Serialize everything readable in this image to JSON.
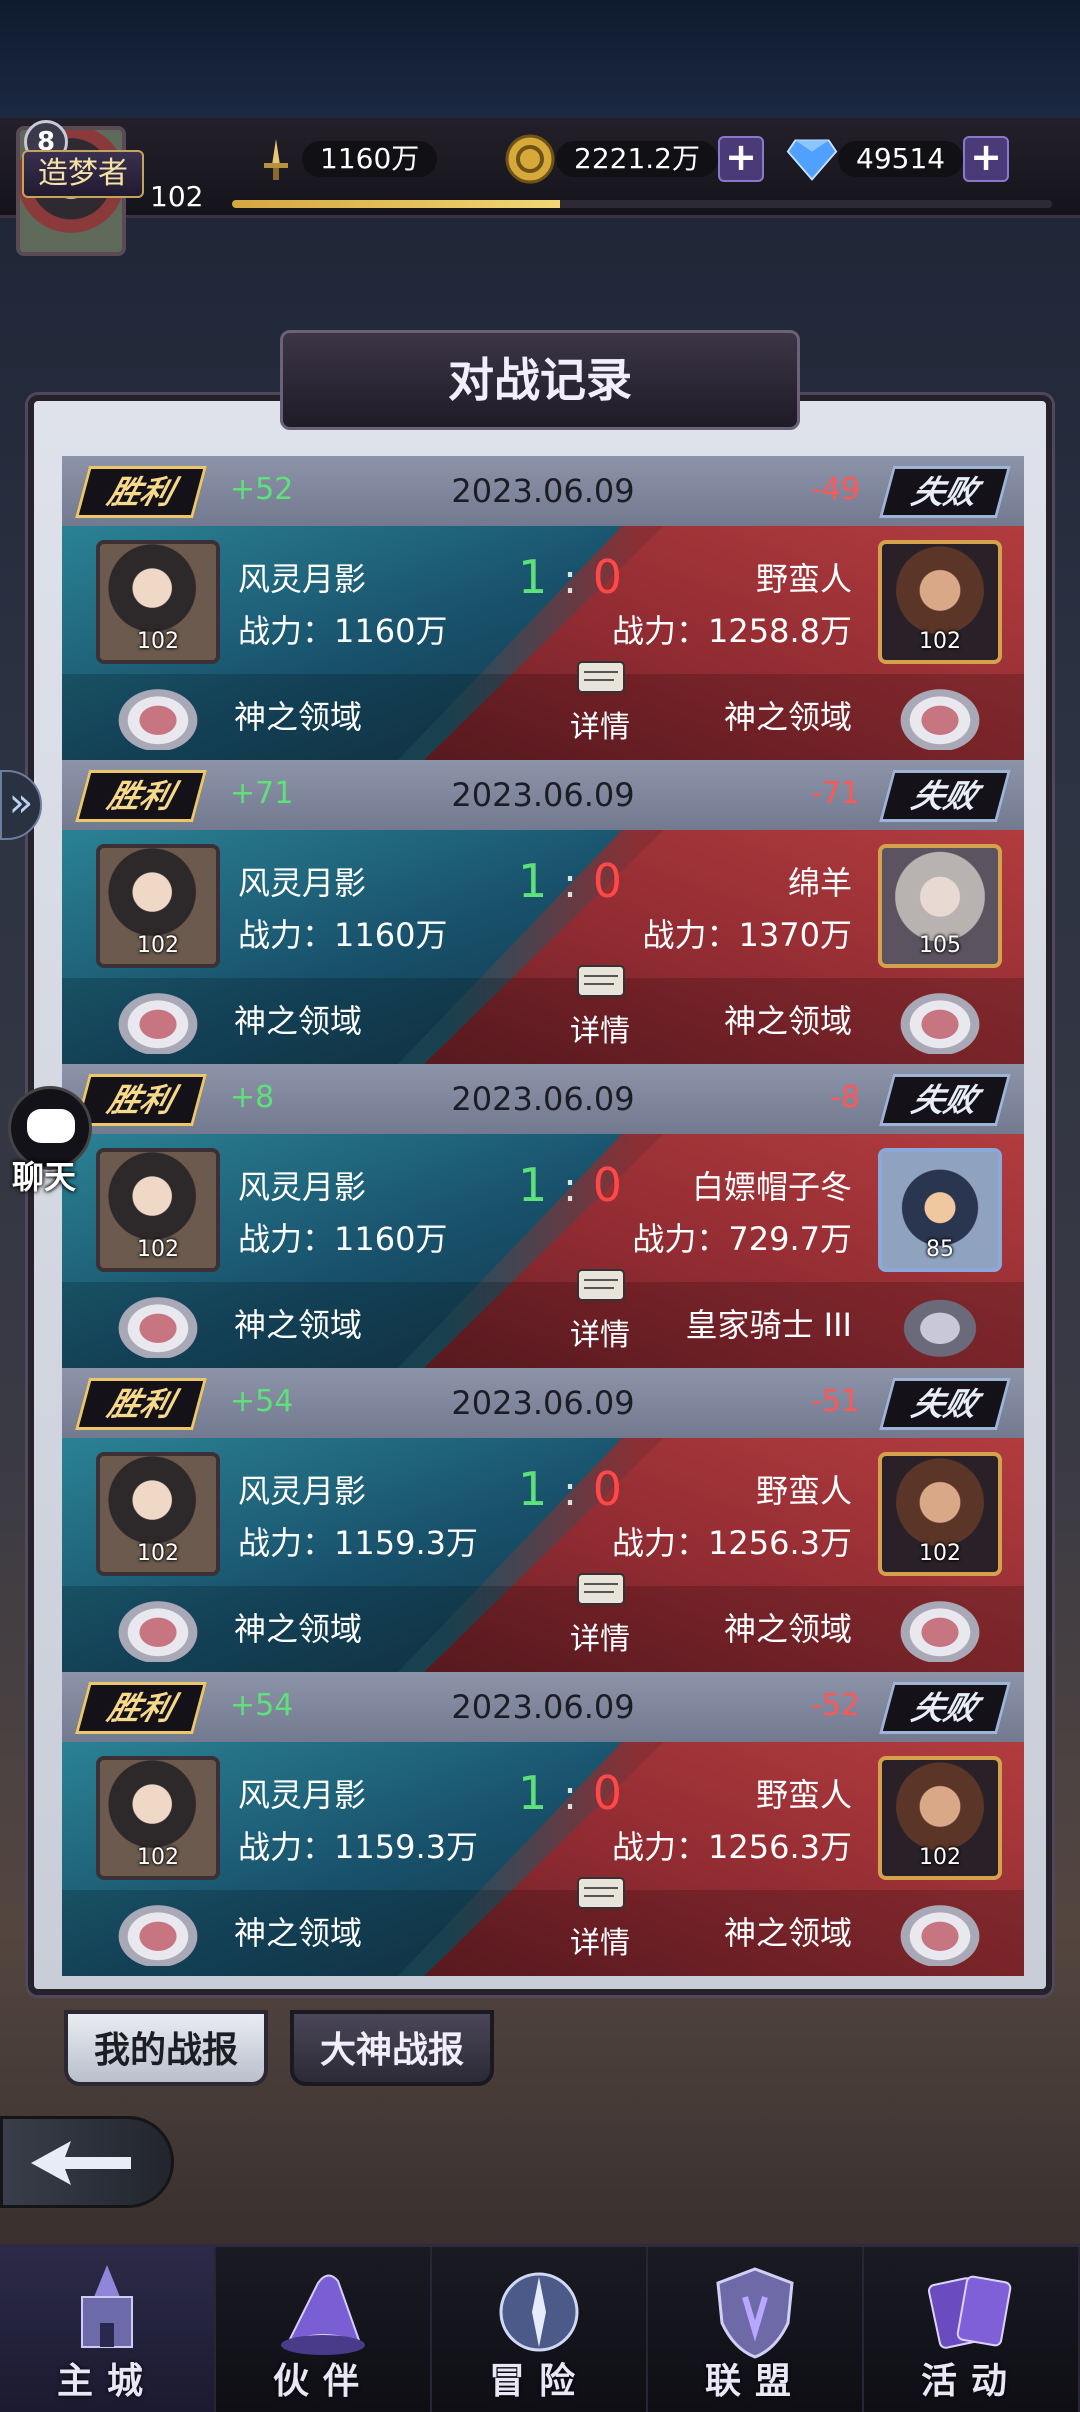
{
  "header": {
    "player_level_badge": "8",
    "player_level": "102",
    "rank_title": "造梦者",
    "resources": {
      "power": "1160万",
      "gold": "2221.2万",
      "gems": "49514"
    },
    "exp_progress": 0.4
  },
  "panel": {
    "title": "对战记录",
    "detail_label": "详情",
    "win_label": "胜利",
    "lose_label": "失败",
    "power_prefix": "战力：",
    "score_sep": ":"
  },
  "records": [
    {
      "win_points": "+52",
      "date": "2023.06.09",
      "lose_points": "-49",
      "me": {
        "name": "风灵月影",
        "power": "战力：1160万",
        "level": "102",
        "domain": "神之领域"
      },
      "score_left": "1",
      "score_right": "0",
      "opp": {
        "name": "野蛮人",
        "power": "战力：1258.8万",
        "level": "102",
        "domain": "神之领域"
      }
    },
    {
      "win_points": "+71",
      "date": "2023.06.09",
      "lose_points": "-71",
      "me": {
        "name": "风灵月影",
        "power": "战力：1160万",
        "level": "102",
        "domain": "神之领域"
      },
      "score_left": "1",
      "score_right": "0",
      "opp": {
        "name": "绵羊",
        "power": "战力：1370万",
        "level": "105",
        "domain": "神之领域"
      }
    },
    {
      "win_points": "+8",
      "date": "2023.06.09",
      "lose_points": "-8",
      "me": {
        "name": "风灵月影",
        "power": "战力：1160万",
        "level": "102",
        "domain": "神之领域"
      },
      "score_left": "1",
      "score_right": "0",
      "opp": {
        "name": "白嫖帽子冬",
        "power": "战力：729.7万",
        "level": "85",
        "domain": "皇家骑士 III"
      }
    },
    {
      "win_points": "+54",
      "date": "2023.06.09",
      "lose_points": "-51",
      "me": {
        "name": "风灵月影",
        "power": "战力：1159.3万",
        "level": "102",
        "domain": "神之领域"
      },
      "score_left": "1",
      "score_right": "0",
      "opp": {
        "name": "野蛮人",
        "power": "战力：1256.3万",
        "level": "102",
        "domain": "神之领域"
      }
    },
    {
      "win_points": "+54",
      "date": "2023.06.09",
      "lose_points": "-52",
      "me": {
        "name": "风灵月影",
        "power": "战力：1159.3万",
        "level": "102",
        "domain": "神之领域"
      },
      "score_left": "1",
      "score_right": "0",
      "opp": {
        "name": "野蛮人",
        "power": "战力：1256.3万",
        "level": "102",
        "domain": "神之领域"
      }
    }
  ],
  "tabs": {
    "my_reports": "我的战报",
    "master_reports": "大神战报"
  },
  "side": {
    "chat_label": "聊天"
  },
  "nav": {
    "items": [
      {
        "label": "主城",
        "icon": "castle-icon"
      },
      {
        "label": "伙伴",
        "icon": "wizard-hat-icon"
      },
      {
        "label": "冒险",
        "icon": "compass-icon"
      },
      {
        "label": "联盟",
        "icon": "shield-icon"
      },
      {
        "label": "活动",
        "icon": "cards-icon"
      }
    ],
    "active_index": 0
  },
  "colors": {
    "win_green": "#5ee07a",
    "lose_red": "#ff4848",
    "gold": "#e9c76a"
  }
}
